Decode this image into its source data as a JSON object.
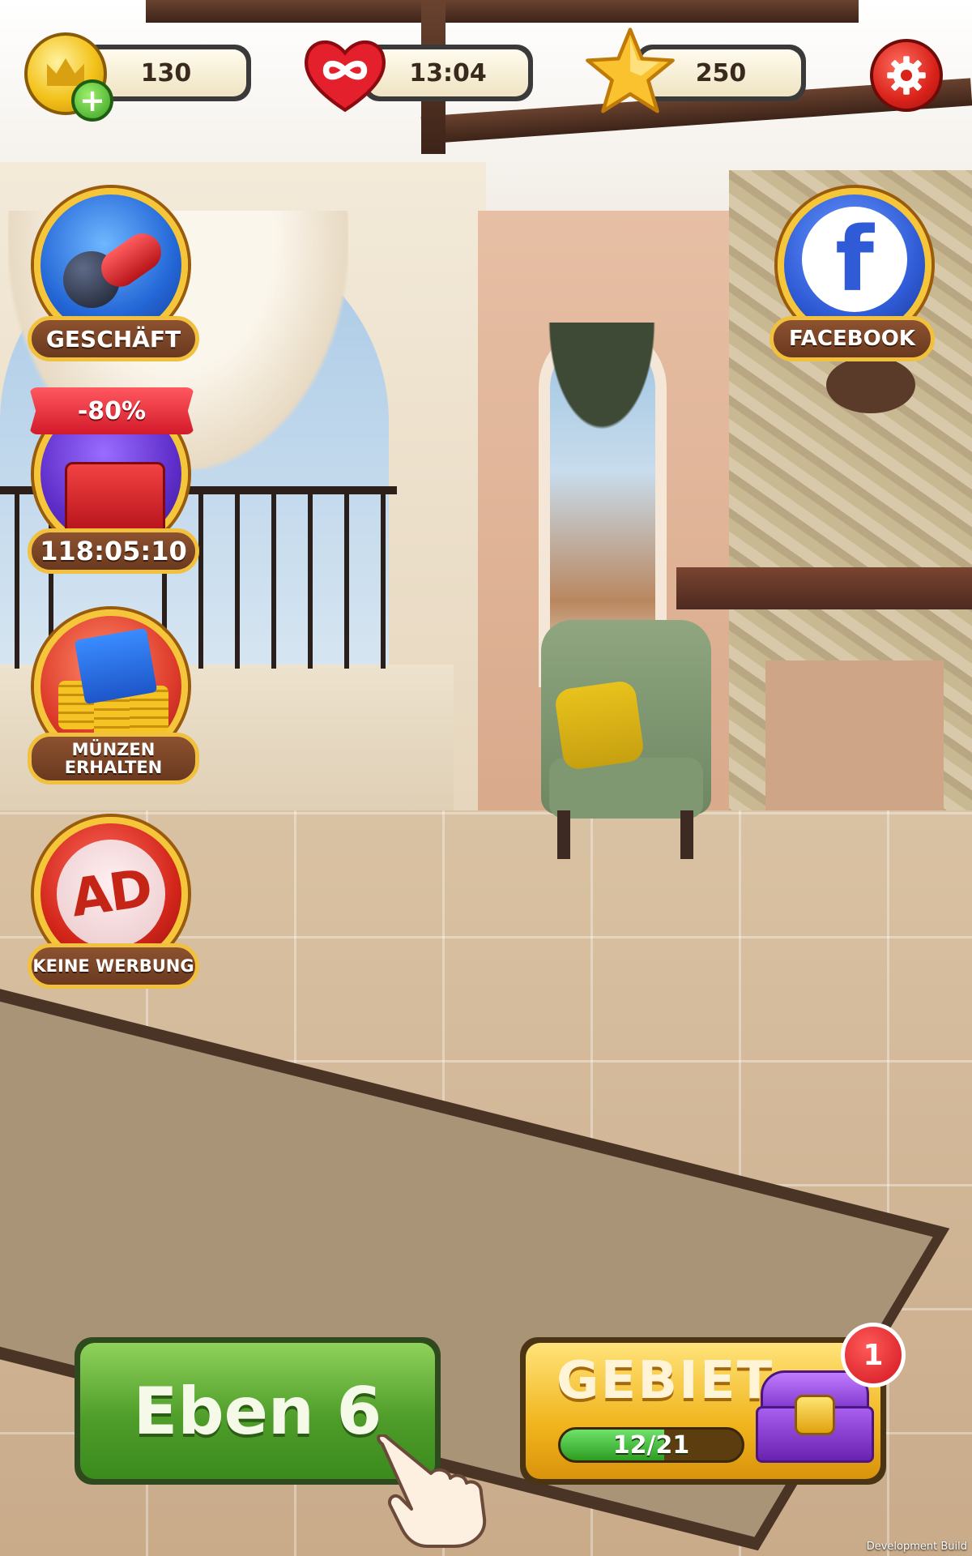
{
  "hud": {
    "coins": "130",
    "lives_timer": "13:04",
    "stars": "250"
  },
  "side_buttons": {
    "shop_label": "GESCHÄFT",
    "sale_badge": "-80%",
    "sale_timer": "118:05:10",
    "coins_label_line1": "MÜNZEN",
    "coins_label_line2": "ERHALTEN",
    "ad_icon_text": "AD",
    "no_ads_label": "KEINE WERBUNG",
    "facebook_label": "FACEBOOK"
  },
  "bottom": {
    "level_label": "Eben 6",
    "area_title": "GEBIET",
    "area_progress_text": "12/21",
    "area_progress_fraction": 0.5714,
    "notification_count": "1"
  },
  "footer": {
    "build_label": "Development Build"
  },
  "colors": {
    "level_button_green": "#4f9d2a",
    "area_button_gold": "#f1b51d",
    "label_border_gold": "#f1c13e",
    "badge_red": "#d1161f"
  },
  "icons": [
    "coin-icon",
    "plus-icon",
    "infinity-heart-icon",
    "star-icon",
    "gear-icon",
    "shop-icon",
    "gift-box-icon",
    "coins-video-icon",
    "ad-icon",
    "facebook-icon",
    "treasure-chest-icon",
    "pointing-hand-icon"
  ]
}
